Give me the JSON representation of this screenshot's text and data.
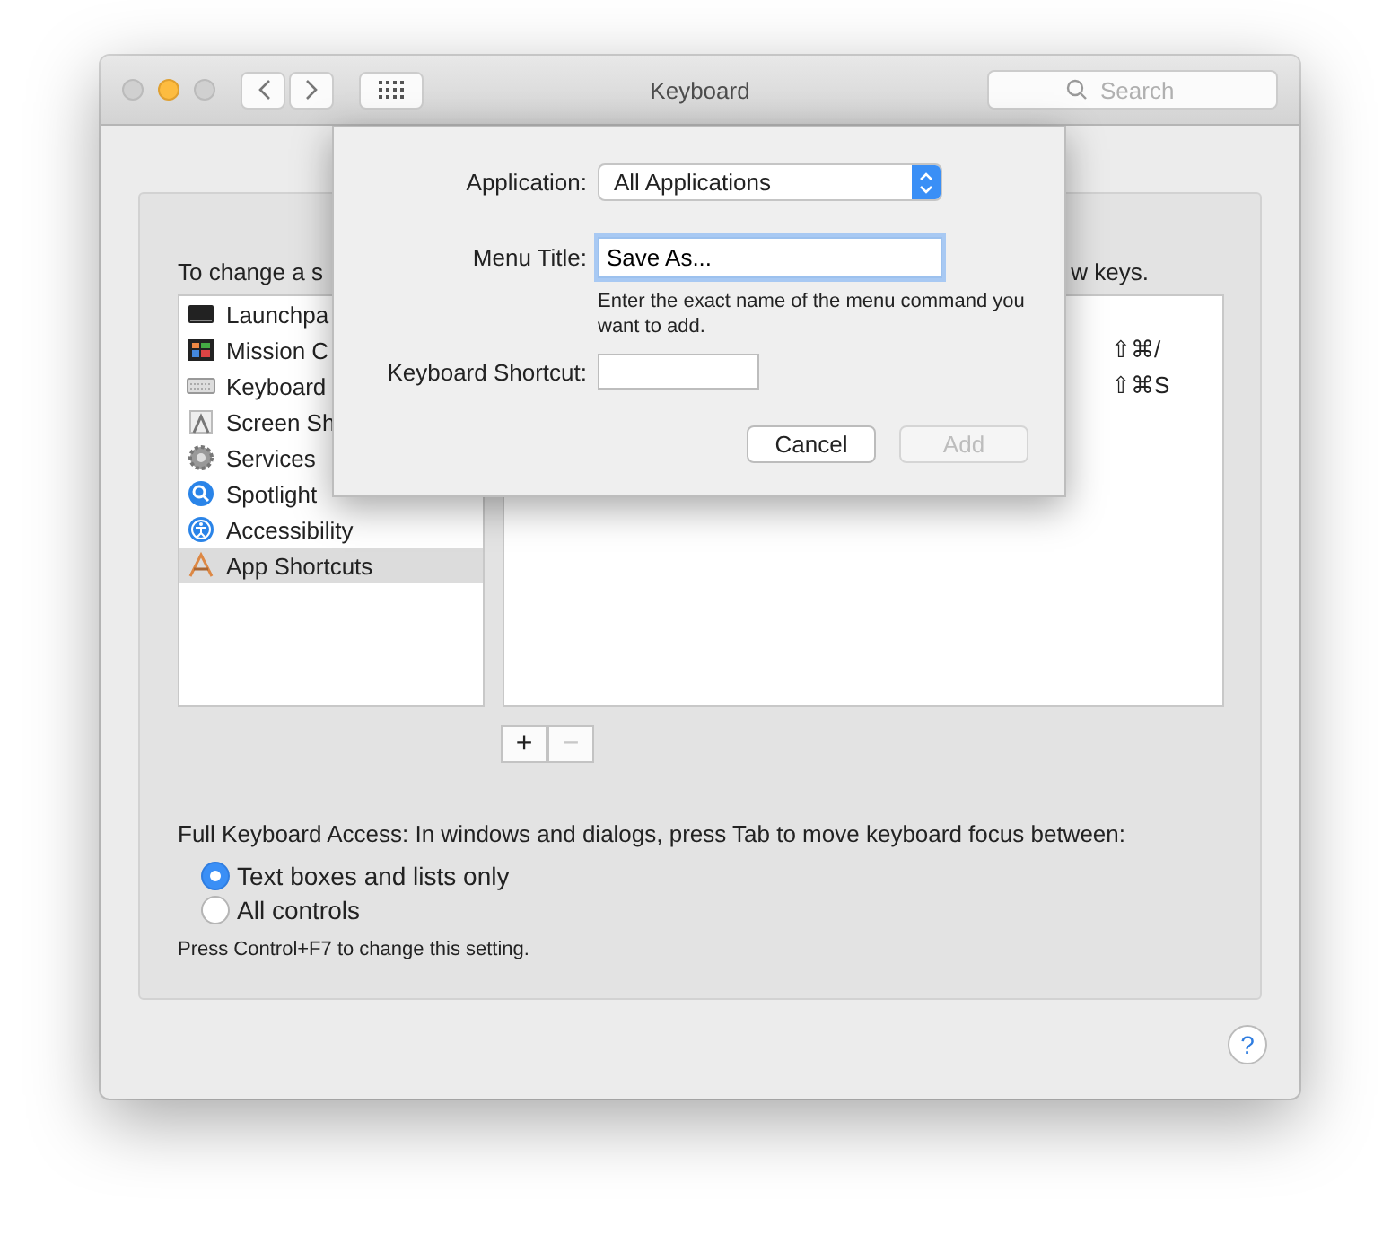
{
  "window": {
    "title": "Keyboard"
  },
  "toolbar": {
    "search": {
      "placeholder": "Search"
    }
  },
  "help": {
    "label": "?"
  },
  "panel": {
    "heading_left": "To change a s",
    "heading_right": "w keys.",
    "categories": [
      {
        "kind": "launchpad",
        "label": "Launchpa",
        "selected": false
      },
      {
        "kind": "mission-control",
        "label": "Mission C",
        "selected": false
      },
      {
        "kind": "keyboard",
        "label": "Keyboard",
        "selected": false
      },
      {
        "kind": "screenshot",
        "label": "Screen Sh",
        "selected": false
      },
      {
        "kind": "services",
        "label": "Services",
        "selected": false
      },
      {
        "kind": "spotlight",
        "label": "Spotlight",
        "selected": false
      },
      {
        "kind": "accessibility",
        "label": "Accessibility",
        "selected": false
      },
      {
        "kind": "app-shortcuts",
        "label": "App Shortcuts",
        "selected": true
      }
    ],
    "shortcuts": [
      {
        "keys": "⇧⌘/"
      },
      {
        "keys": "⇧⌘S"
      }
    ],
    "list_buttons": [
      {
        "label": "+",
        "disabled": false
      },
      {
        "label": "−",
        "disabled": true
      }
    ],
    "keyboard_access": {
      "label": "Full Keyboard Access: In windows and dialogs, press Tab to move keyboard focus between:",
      "options": [
        {
          "label": "Text boxes and lists only",
          "selected": true
        },
        {
          "label": "All controls",
          "selected": false
        }
      ],
      "note": "Press Control+F7 to change this setting."
    }
  },
  "sheet": {
    "application_label": "Application:",
    "application_value": "All Applications",
    "menu_title_label": "Menu Title:",
    "menu_title_value": "Save As...",
    "hint": "Enter the exact name of the menu command you want to add.",
    "shortcut_label": "Keyboard Shortcut:",
    "buttons": [
      {
        "label": "Cancel",
        "disabled": false
      },
      {
        "label": "Add",
        "disabled": true
      }
    ]
  }
}
